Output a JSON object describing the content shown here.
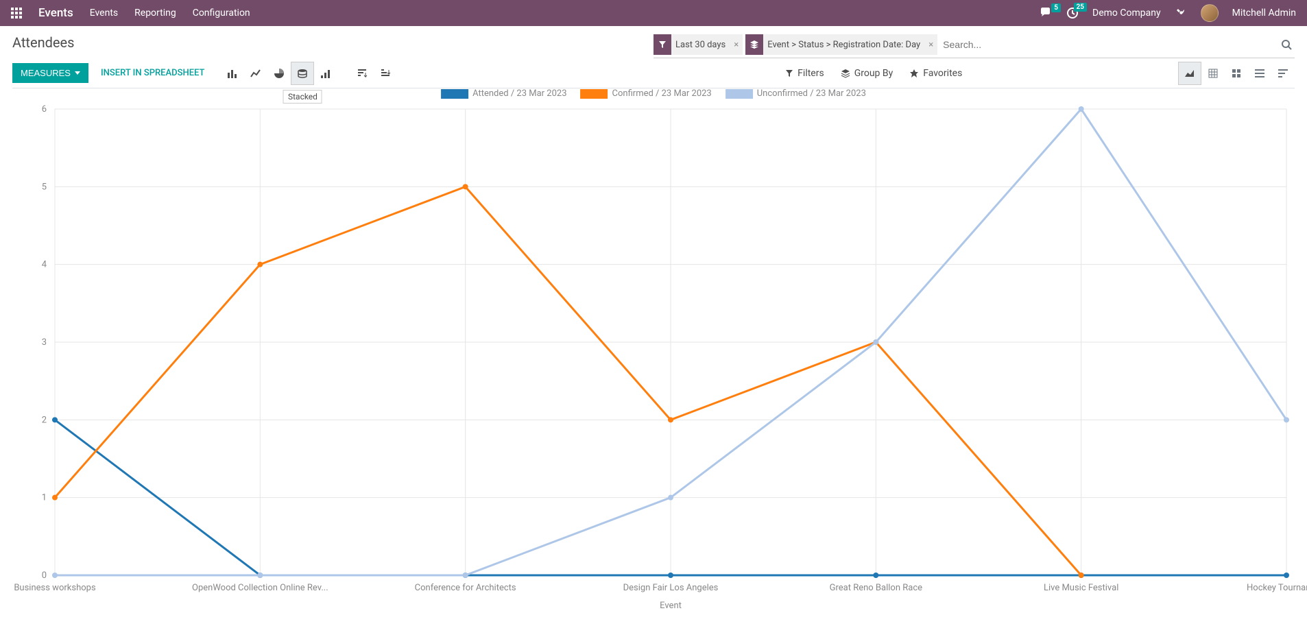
{
  "navbar": {
    "app_title": "Events",
    "links": [
      "Events",
      "Reporting",
      "Configuration"
    ],
    "msg_badge": "5",
    "activity_badge": "25",
    "company": "Demo Company",
    "user": "Mitchell Admin"
  },
  "page": {
    "title": "Attendees"
  },
  "search": {
    "facets": [
      {
        "icon": "filter",
        "text": "Last 30 days"
      },
      {
        "icon": "group",
        "text": "Event > Status > Registration Date: Day"
      }
    ],
    "placeholder": "Search..."
  },
  "controls": {
    "measures_label": "MEASURES",
    "insert_label": "INSERT IN SPREADSHEET",
    "tooltip": "Stacked",
    "filters_label": "Filters",
    "groupby_label": "Group By",
    "favorites_label": "Favorites"
  },
  "chart_data": {
    "type": "line",
    "title": "",
    "xlabel": "Event",
    "ylabel": "",
    "ylim": [
      0,
      6
    ],
    "categories": [
      "Business workshops",
      "OpenWood Collection Online Rev...",
      "Conference for Architects",
      "Design Fair Los Angeles",
      "Great Reno Ballon Race",
      "Live Music Festival",
      "Hockey Tournament"
    ],
    "series": [
      {
        "name": "Attended / 23 Mar 2023",
        "color": "#1f77b4",
        "values": [
          2,
          0,
          0,
          0,
          0,
          0,
          0
        ]
      },
      {
        "name": "Confirmed / 23 Mar 2023",
        "color": "#ff7f0e",
        "values": [
          1,
          4,
          5,
          2,
          3,
          0,
          null
        ]
      },
      {
        "name": "Unconfirmed / 23 Mar 2023",
        "color": "#aec7e8",
        "values": [
          0,
          0,
          0,
          1,
          3,
          6,
          2
        ]
      }
    ],
    "y_ticks": [
      0,
      1,
      2,
      3,
      4,
      5,
      6
    ]
  }
}
